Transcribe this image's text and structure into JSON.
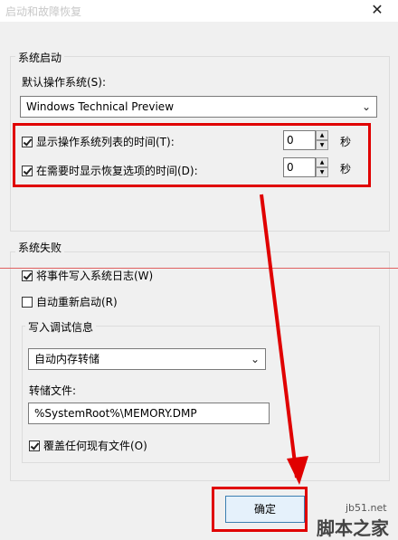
{
  "window": {
    "title": "启动和故障恢复",
    "close_glyph": "✕"
  },
  "startup": {
    "group_label": "系统启动",
    "default_os_label": "默认操作系统(S):",
    "default_os_value": "Windows Technical Preview",
    "show_os_list": {
      "label": "显示操作系统列表的时间(T):",
      "checked": true,
      "value": "0",
      "unit": "秒"
    },
    "show_recovery": {
      "label": "在需要时显示恢复选项的时间(D):",
      "checked": true,
      "value": "0",
      "unit": "秒"
    }
  },
  "failure": {
    "group_label": "系统失败",
    "write_event": {
      "label": "将事件写入系统日志(W)",
      "checked": true
    },
    "auto_restart": {
      "label": "自动重新启动(R)",
      "checked": false
    },
    "debug": {
      "group_label": "写入调试信息",
      "dump_type_value": "自动内存转储",
      "dump_file_label": "转储文件:",
      "dump_file_value": "%SystemRoot%\\MEMORY.DMP",
      "overwrite": {
        "label": "覆盖任何现有文件(O)",
        "checked": true
      }
    }
  },
  "buttons": {
    "ok_label": "确定"
  },
  "annotation_colors": {
    "highlight": "#e00000",
    "guide_line": "#e06060"
  },
  "watermark": {
    "site": "jb51.net",
    "name": "脚本之家"
  }
}
